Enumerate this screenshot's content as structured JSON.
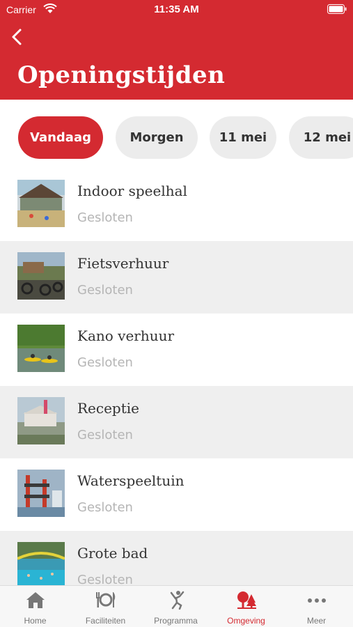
{
  "status_bar": {
    "carrier": "Carrier",
    "time": "11:35 AM"
  },
  "header": {
    "title": "Openingstijden",
    "back_icon": "chevron-left-icon"
  },
  "accent_color": "#d42a31",
  "day_tabs": [
    {
      "label": "Vandaag",
      "active": true
    },
    {
      "label": "Morgen",
      "active": false
    },
    {
      "label": "11 mei",
      "active": false
    },
    {
      "label": "12 mei",
      "active": false
    }
  ],
  "facilities": [
    {
      "name": "Indoor speelhal",
      "status": "Gesloten"
    },
    {
      "name": "Fietsverhuur",
      "status": "Gesloten"
    },
    {
      "name": "Kano verhuur",
      "status": "Gesloten"
    },
    {
      "name": "Receptie",
      "status": "Gesloten"
    },
    {
      "name": "Waterspeeltuin",
      "status": "Gesloten"
    },
    {
      "name": "Grote bad",
      "status": "Gesloten"
    }
  ],
  "tab_bar": [
    {
      "label": "Home",
      "icon": "house-icon",
      "active": false
    },
    {
      "label": "Faciliteiten",
      "icon": "cutlery-icon",
      "active": false
    },
    {
      "label": "Programma",
      "icon": "dancing-person-icon",
      "active": false
    },
    {
      "label": "Omgeving",
      "icon": "trees-icon",
      "active": true
    },
    {
      "label": "Meer",
      "icon": "more-dots-icon",
      "active": false
    }
  ]
}
